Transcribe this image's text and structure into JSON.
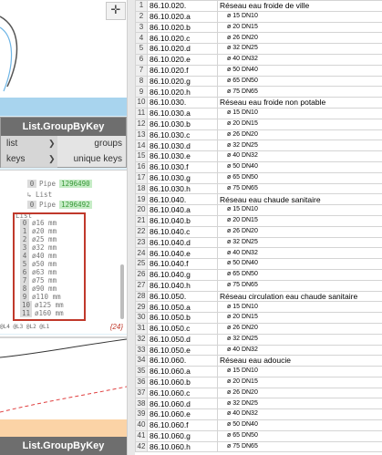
{
  "canvas": {
    "pan_icon": "✛",
    "group_by_key_title": "List.GroupByKey",
    "inputs": [
      "list",
      "keys"
    ],
    "outputs": [
      "groups",
      "unique keys"
    ],
    "watch_lines": [
      {
        "index": "0",
        "text": "Pipe",
        "id": "1296490"
      },
      {
        "label": "List"
      },
      {
        "index": "0",
        "text": "Pipe",
        "id": "1296492"
      },
      {
        "label": "List"
      }
    ],
    "sizes": [
      {
        "index": "0",
        "text": "ø16 mm"
      },
      {
        "index": "1",
        "text": "ø20 mm"
      },
      {
        "index": "2",
        "text": "ø25 mm"
      },
      {
        "index": "3",
        "text": "ø32 mm"
      },
      {
        "index": "4",
        "text": "ø40 mm"
      },
      {
        "index": "5",
        "text": "ø50 mm"
      },
      {
        "index": "6",
        "text": "ø63 mm"
      },
      {
        "index": "7",
        "text": "ø75 mm"
      },
      {
        "index": "8",
        "text": "ø90 mm"
      },
      {
        "index": "9",
        "text": "ø110 mm"
      },
      {
        "index": "10",
        "text": "ø125 mm"
      },
      {
        "index": "11",
        "text": "ø160 mm"
      }
    ],
    "footer_levels": "@L4 @L3 @L2 @L1",
    "footer_count": "{24}",
    "group_by_key_title_2": "List.GroupByKey"
  },
  "sheet": {
    "rows": [
      {
        "n": "1",
        "code": "86.10.020.",
        "desc": "Réseau eau froide de ville",
        "sub": false
      },
      {
        "n": "2",
        "code": "86.10.020.a",
        "desc": "ø 15 DN10",
        "sub": true
      },
      {
        "n": "3",
        "code": "86.10.020.b",
        "desc": "ø 20 DN15",
        "sub": true
      },
      {
        "n": "4",
        "code": "86.10.020.c",
        "desc": "ø 26 DN20",
        "sub": true
      },
      {
        "n": "5",
        "code": "86.10.020.d",
        "desc": "ø 32 DN25",
        "sub": true
      },
      {
        "n": "6",
        "code": "86.10.020.e",
        "desc": "ø 40 DN32",
        "sub": true
      },
      {
        "n": "7",
        "code": "86.10.020.f",
        "desc": "ø 50 DN40",
        "sub": true
      },
      {
        "n": "8",
        "code": "86.10.020.g",
        "desc": "ø 65 DN50",
        "sub": true
      },
      {
        "n": "9",
        "code": "86.10.020.h",
        "desc": "ø 75 DN65",
        "sub": true
      },
      {
        "n": "10",
        "code": "86.10.030.",
        "desc": "Réseau eau froide non potable",
        "sub": false
      },
      {
        "n": "11",
        "code": "86.10.030.a",
        "desc": "ø 15 DN10",
        "sub": true
      },
      {
        "n": "12",
        "code": "86.10.030.b",
        "desc": "ø 20 DN15",
        "sub": true
      },
      {
        "n": "13",
        "code": "86.10.030.c",
        "desc": "ø 26 DN20",
        "sub": true
      },
      {
        "n": "14",
        "code": "86.10.030.d",
        "desc": "ø 32 DN25",
        "sub": true
      },
      {
        "n": "15",
        "code": "86.10.030.e",
        "desc": "ø 40 DN32",
        "sub": true
      },
      {
        "n": "16",
        "code": "86.10.030.f",
        "desc": "ø 50 DN40",
        "sub": true
      },
      {
        "n": "17",
        "code": "86.10.030.g",
        "desc": "ø 65 DN50",
        "sub": true
      },
      {
        "n": "18",
        "code": "86.10.030.h",
        "desc": "ø 75 DN65",
        "sub": true
      },
      {
        "n": "19",
        "code": "86.10.040.",
        "desc": "Réseau eau chaude sanitaire",
        "sub": false
      },
      {
        "n": "20",
        "code": "86.10.040.a",
        "desc": "ø 15 DN10",
        "sub": true
      },
      {
        "n": "21",
        "code": "86.10.040.b",
        "desc": "ø 20 DN15",
        "sub": true
      },
      {
        "n": "22",
        "code": "86.10.040.c",
        "desc": "ø 26 DN20",
        "sub": true
      },
      {
        "n": "23",
        "code": "86.10.040.d",
        "desc": "ø 32 DN25",
        "sub": true
      },
      {
        "n": "24",
        "code": "86.10.040.e",
        "desc": "ø 40 DN32",
        "sub": true
      },
      {
        "n": "25",
        "code": "86.10.040.f",
        "desc": "ø 50 DN40",
        "sub": true
      },
      {
        "n": "26",
        "code": "86.10.040.g",
        "desc": "ø 65 DN50",
        "sub": true
      },
      {
        "n": "27",
        "code": "86.10.040.h",
        "desc": "ø 75 DN65",
        "sub": true
      },
      {
        "n": "28",
        "code": "86.10.050.",
        "desc": "Réseau circulation eau chaude sanitaire",
        "sub": false
      },
      {
        "n": "29",
        "code": "86.10.050.a",
        "desc": "ø 15 DN10",
        "sub": true
      },
      {
        "n": "30",
        "code": "86.10.050.b",
        "desc": "ø 20 DN15",
        "sub": true
      },
      {
        "n": "31",
        "code": "86.10.050.c",
        "desc": "ø 26 DN20",
        "sub": true
      },
      {
        "n": "32",
        "code": "86.10.050.d",
        "desc": "ø 32 DN25",
        "sub": true
      },
      {
        "n": "33",
        "code": "86.10.050.e",
        "desc": "ø 40 DN32",
        "sub": true
      },
      {
        "n": "34",
        "code": "86.10.060.",
        "desc": "Réseau eau adoucie",
        "sub": false
      },
      {
        "n": "35",
        "code": "86.10.060.a",
        "desc": "ø 15 DN10",
        "sub": true
      },
      {
        "n": "36",
        "code": "86.10.060.b",
        "desc": "ø 20 DN15",
        "sub": true
      },
      {
        "n": "37",
        "code": "86.10.060.c",
        "desc": "ø 26 DN20",
        "sub": true
      },
      {
        "n": "38",
        "code": "86.10.060.d",
        "desc": "ø 32 DN25",
        "sub": true
      },
      {
        "n": "39",
        "code": "86.10.060.e",
        "desc": "ø 40 DN32",
        "sub": true
      },
      {
        "n": "40",
        "code": "86.10.060.f",
        "desc": "ø 50 DN40",
        "sub": true
      },
      {
        "n": "41",
        "code": "86.10.060.g",
        "desc": "ø 65 DN50",
        "sub": true
      },
      {
        "n": "42",
        "code": "86.10.060.h",
        "desc": "ø 75 DN65",
        "sub": true
      }
    ]
  },
  "colors": {
    "group_blue": "#a8d4ee",
    "group_orange": "#fbd3a6",
    "highlight": "#c0392b",
    "id_green": "#3a9a3a"
  }
}
